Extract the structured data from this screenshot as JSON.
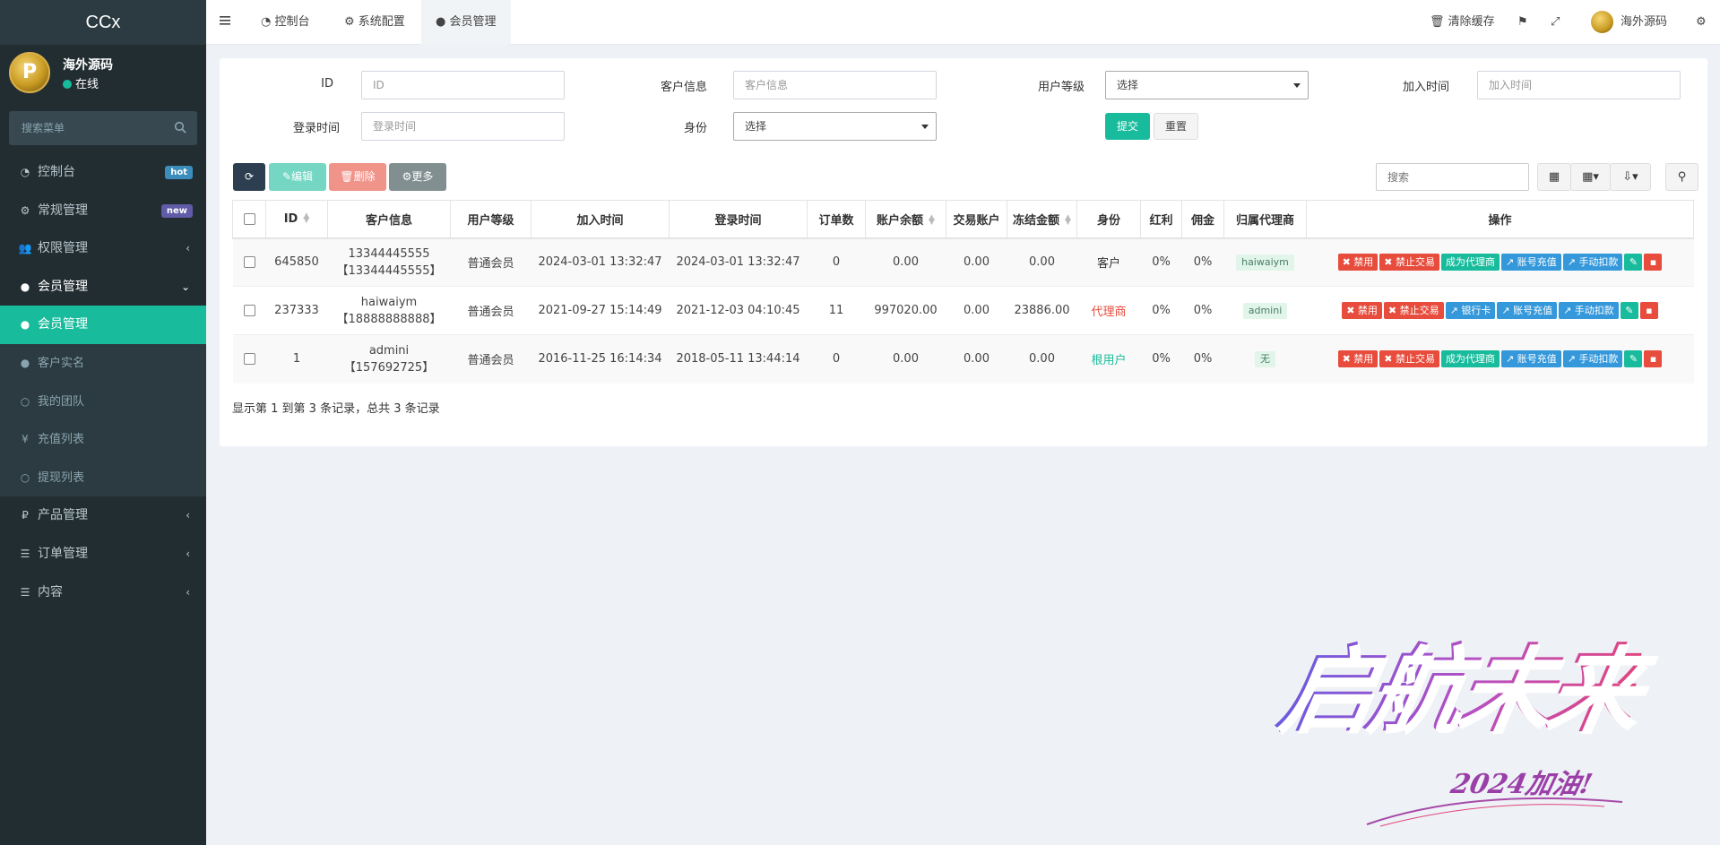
{
  "sidebar": {
    "brand": "CCx",
    "avatar_letter": "P",
    "user_name": "海外源码",
    "user_status": "在线",
    "search_placeholder": "搜索菜单",
    "items": [
      {
        "label": "控制台",
        "icon": "dashboard-icon",
        "badge": "hot"
      },
      {
        "label": "常规管理",
        "icon": "cogs-icon",
        "badge": "new"
      },
      {
        "label": "权限管理",
        "icon": "group-icon",
        "arrow": "‹"
      },
      {
        "label": "会员管理",
        "icon": "user-circle-icon",
        "arrow": "⌄"
      },
      {
        "label": "会员管理",
        "icon": "user-icon"
      },
      {
        "label": "客户实名",
        "icon": "user-icon"
      },
      {
        "label": "我的团队",
        "icon": "circle-icon"
      },
      {
        "label": "充值列表",
        "icon": "yen-icon"
      },
      {
        "label": "提现列表",
        "icon": "circle-icon"
      },
      {
        "label": "产品管理",
        "icon": "ruble-icon",
        "arrow": "‹"
      },
      {
        "label": "订单管理",
        "icon": "list-icon",
        "arrow": "‹"
      },
      {
        "label": "内容",
        "icon": "list-icon",
        "arrow": "‹"
      }
    ]
  },
  "header": {
    "tabs": [
      {
        "label": "控制台",
        "icon": "dashboard-icon"
      },
      {
        "label": "系统配置",
        "icon": "gear-icon"
      },
      {
        "label": "会员管理",
        "icon": "user-icon"
      }
    ],
    "clear_cache": "清除缓存",
    "user_name": "海外源码"
  },
  "filters": {
    "id_label": "ID",
    "id_placeholder": "ID",
    "customer_label": "客户信息",
    "customer_placeholder": "客户信息",
    "level_label": "用户等级",
    "level_value": "选择",
    "join_label": "加入时间",
    "join_placeholder": "加入时间",
    "login_label": "登录时间",
    "login_placeholder": "登录时间",
    "identity_label": "身份",
    "identity_value": "选择",
    "submit": "提交",
    "reset": "重置"
  },
  "toolbar": {
    "edit": "编辑",
    "delete": "删除",
    "more": "更多",
    "search_placeholder": "搜索"
  },
  "table": {
    "columns": [
      "ID",
      "客户信息",
      "用户等级",
      "加入时间",
      "登录时间",
      "订单数",
      "账户余额",
      "交易账户",
      "冻结金额",
      "身份",
      "红利",
      "佣金",
      "归属代理商",
      "操作"
    ],
    "rows": [
      {
        "id": "645850",
        "customer": "13344445555",
        "customer2": "【13344445555】",
        "level": "普通会员",
        "join": "2024-03-01 13:32:47",
        "login": "2024-03-01 13:32:47",
        "orders": "0",
        "balance": "0.00",
        "trade": "0.00",
        "frozen": "0.00",
        "role": "客户",
        "bonus": "0%",
        "commission": "0%",
        "agent": "haiwaiym",
        "ops": [
          "禁用",
          "禁止交易",
          "成为代理商",
          "账号充值",
          "手动扣款"
        ]
      },
      {
        "id": "237333",
        "customer": "haiwaiym",
        "customer2": "【18888888888】",
        "level": "普通会员",
        "join": "2021-09-27 15:14:49",
        "login": "2021-12-03 04:10:45",
        "orders": "11",
        "balance": "997020.00",
        "trade": "0.00",
        "frozen": "23886.00",
        "role": "代理商",
        "bonus": "0%",
        "commission": "0%",
        "agent": "admini",
        "ops": [
          "禁用",
          "禁止交易",
          "银行卡",
          "账号充值",
          "手动扣款"
        ]
      },
      {
        "id": "1",
        "customer": "admini",
        "customer2": "【157692725】",
        "level": "普通会员",
        "join": "2016-11-25 16:14:34",
        "login": "2018-05-11 13:44:14",
        "orders": "0",
        "balance": "0.00",
        "trade": "0.00",
        "frozen": "0.00",
        "role": "根用户",
        "bonus": "0%",
        "commission": "0%",
        "agent": "无",
        "ops": [
          "禁用",
          "禁止交易",
          "成为代理商",
          "账号充值",
          "手动扣款"
        ]
      }
    ]
  },
  "pagination_info": "显示第 1 到第 3 条记录，总共 3 条记录",
  "watermark": {
    "main": "启航未来",
    "sub": "2024加油!"
  },
  "colors": {
    "primary": "#18bc9c",
    "sidebar": "#222d32",
    "danger": "#e74c3c",
    "info": "#3498db"
  }
}
